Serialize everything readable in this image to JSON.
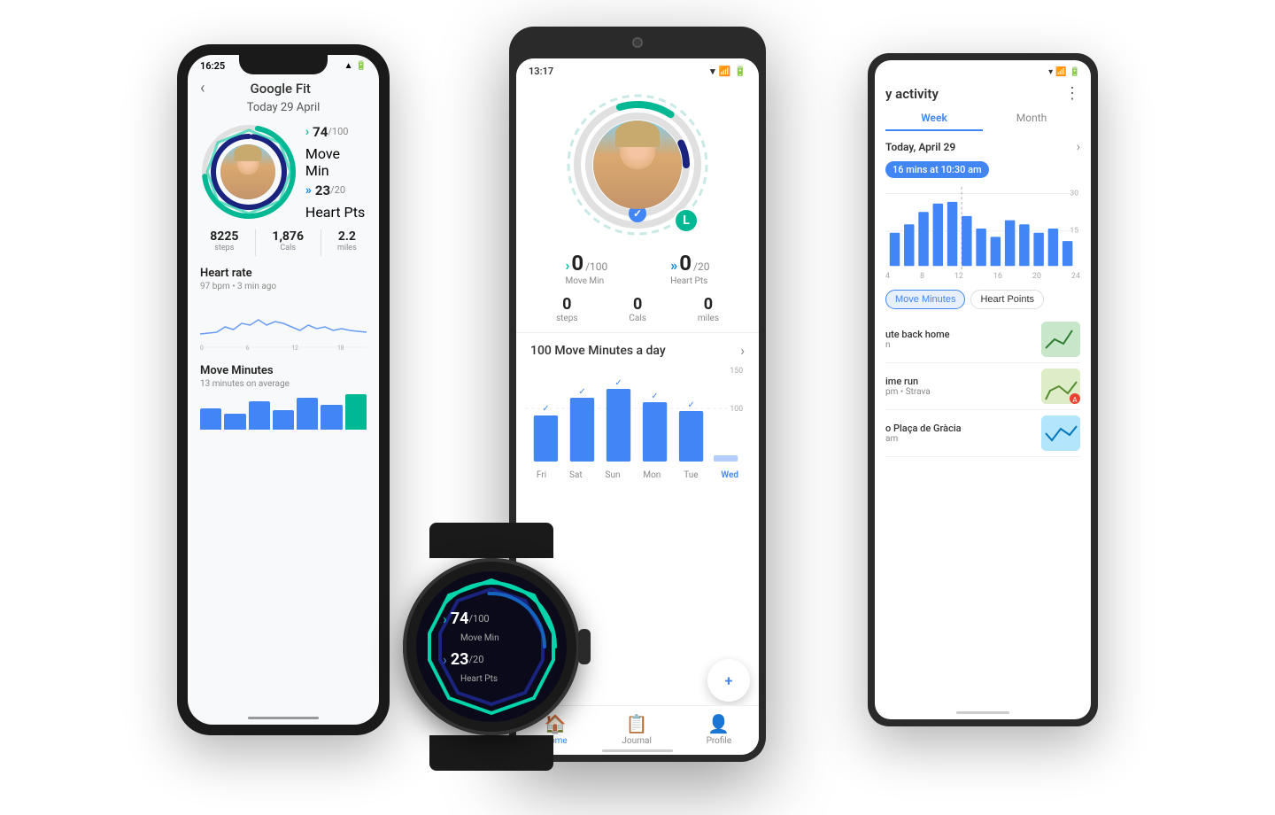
{
  "iphone": {
    "status_time": "16:25",
    "title": "Google Fit",
    "date": "Today 29 April",
    "move_min_value": "74",
    "move_min_total": "100",
    "move_min_label": "Move Min",
    "heart_pts_value": "23",
    "heart_pts_total": "20",
    "heart_pts_label": "Heart Pts",
    "steps": "8225",
    "steps_label": "steps",
    "cals": "1,876",
    "cals_label": "Cals",
    "miles": "2.2",
    "miles_label": "miles",
    "heart_rate_title": "Heart rate",
    "heart_rate_value": "97 bpm • 3 min ago",
    "move_min_section": "Move Minutes",
    "move_min_sub": "13 minutes on average"
  },
  "android_center": {
    "status_time": "13:17",
    "move_min_value": "0",
    "move_min_total": "100",
    "move_min_label": "Move Min",
    "heart_pts_value": "0",
    "heart_pts_total": "20",
    "heart_pts_label": "Heart Pts",
    "steps": "0",
    "steps_label": "steps",
    "cals": "0",
    "cals_label": "Cals",
    "miles": "0",
    "miles_label": "miles",
    "chart_title": "100 Move Minutes a day",
    "days": [
      "Fri",
      "Sat",
      "Sun",
      "Mon",
      "Tue",
      "Wed"
    ],
    "nav": {
      "home": "Home",
      "journal": "Journal",
      "profile": "Profile"
    }
  },
  "android_right": {
    "title": "y activity",
    "tabs": [
      "Week",
      "Month"
    ],
    "date": "Today, April 29",
    "badge": "16 mins at 10:30 am",
    "filter_buttons": [
      "Move Minutes",
      "Heart Points"
    ],
    "activities": [
      {
        "name": "ute back home",
        "detail": "n"
      },
      {
        "name": "ime run",
        "detail": "pm • Strava"
      },
      {
        "name": "o Plaça de Gràcia",
        "detail": "am"
      }
    ]
  },
  "watch": {
    "move_min_value": "74",
    "move_min_total": "100",
    "move_min_label": "Move Min",
    "heart_pts_value": "23",
    "heart_pts_total": "20",
    "heart_pts_label": "Heart Pts"
  },
  "colors": {
    "teal": "#00b894",
    "blue": "#4285f4",
    "dark_blue": "#1a237e",
    "light_teal": "#b2dfdb",
    "google_yellow": "#fbbc05",
    "google_red": "#ea4335",
    "google_green": "#34a853"
  }
}
